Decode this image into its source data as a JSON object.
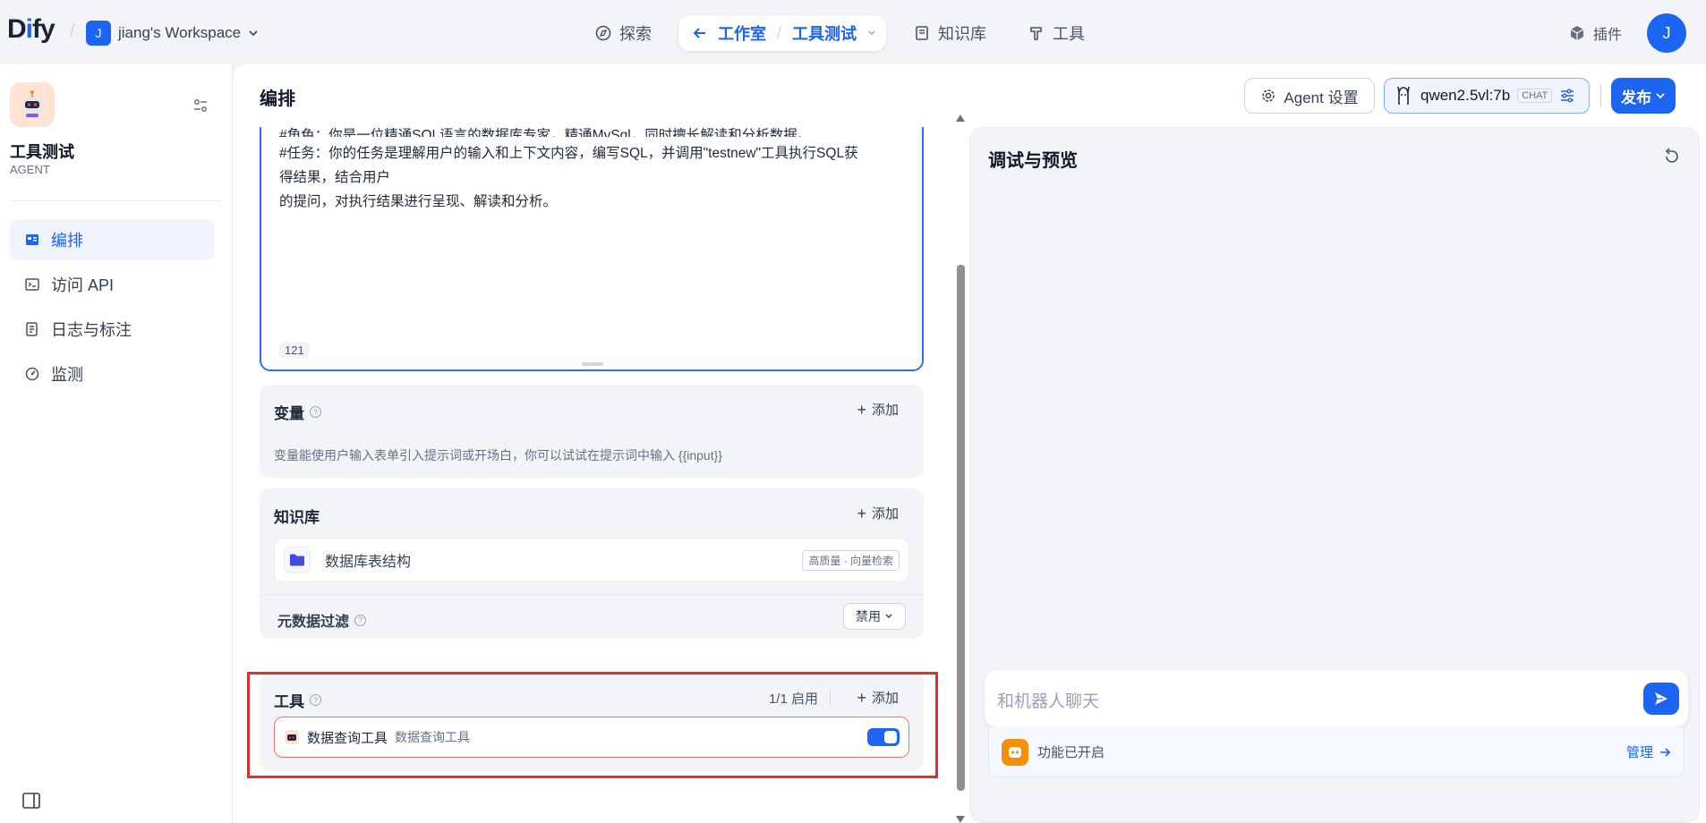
{
  "topbar": {
    "logo_text": "Dify",
    "workspace_initial": "J",
    "workspace_name": "jiang's Workspace",
    "nav": {
      "explore": "探索",
      "studio": "工作室",
      "current_app": "工具测试",
      "knowledge": "知识库",
      "tools": "工具",
      "plugins": "插件"
    },
    "user_initial": "J"
  },
  "sidebar": {
    "app_name": "工具测试",
    "app_type": "AGENT",
    "items": [
      {
        "label": "编排",
        "icon": "layout-icon",
        "active": true
      },
      {
        "label": "访问 API",
        "icon": "terminal-icon",
        "active": false
      },
      {
        "label": "日志与标注",
        "icon": "document-icon",
        "active": false
      },
      {
        "label": "监测",
        "icon": "gauge-icon",
        "active": false
      }
    ]
  },
  "header": {
    "title": "编排",
    "agent_settings": "Agent 设置",
    "model_name": "qwen2.5vl:7b",
    "model_mode": "CHAT",
    "publish": "发布"
  },
  "prompt": {
    "line0": "#角色：你是一位精通SQL语言的数据库专家，精通MySql，同时擅长解读和分析数据。",
    "line1": "#任务：你的任务是理解用户的输入和上下文内容，编写SQL，并调用\"testnew\"工具执行SQL获",
    "line2": "得结果，结合用户",
    "line3": "的提问，对执行结果进行呈现、解读和分析。",
    "char_count": "121"
  },
  "variables": {
    "title": "变量",
    "add": "添加",
    "description": "变量能使用户输入表单引入提示词或开场白，你可以试试在提示词中输入 {{input}}"
  },
  "knowledge": {
    "title": "知识库",
    "add": "添加",
    "item_name": "数据库表结构",
    "item_tag": "高质量 · 向量检索",
    "metadata_filter": "元数据过滤",
    "metadata_value": "禁用"
  },
  "tools": {
    "title": "工具",
    "status": "1/1 启用",
    "add": "添加",
    "item_name": "数据查询工具",
    "item_desc": "数据查询工具",
    "enabled": true
  },
  "debug": {
    "title": "调试与预览",
    "input_placeholder": "和机器人聊天",
    "feature_text": "功能已开启",
    "manage": "管理"
  },
  "colors": {
    "primary": "#1c64f2",
    "highlight": "#e52b2b"
  }
}
